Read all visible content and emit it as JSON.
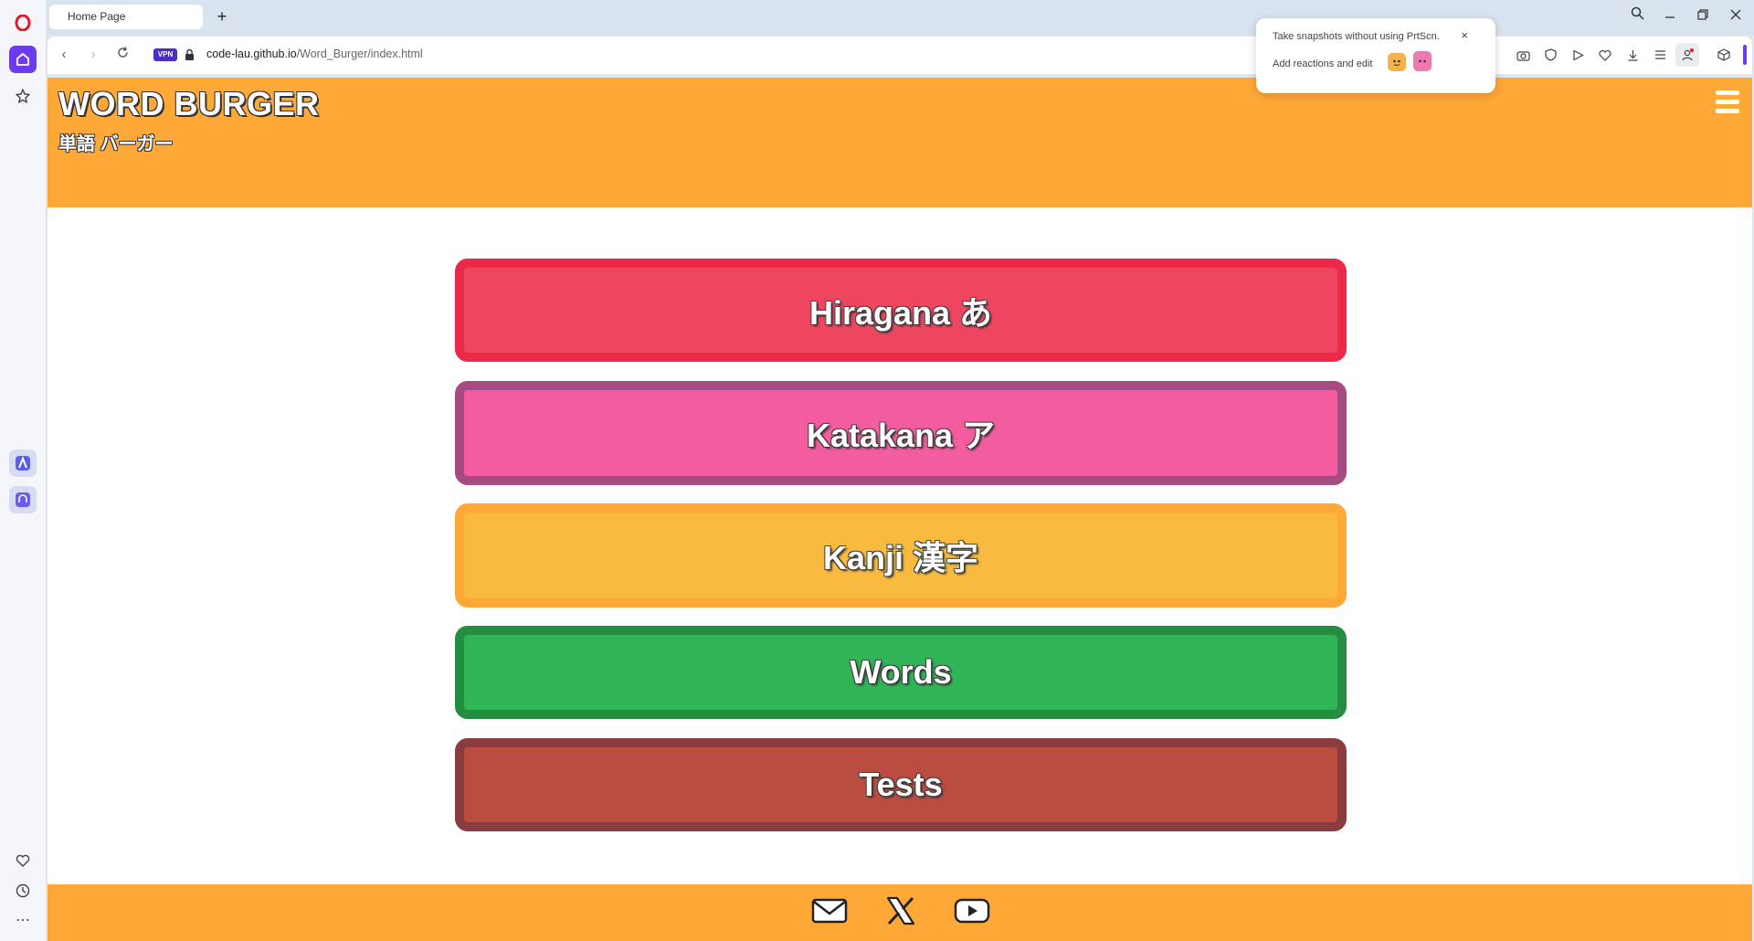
{
  "browser": {
    "tab_title": "Home Page",
    "new_tab": "+",
    "vpn_label": "VPN",
    "url_host": "code-lau.github.io",
    "url_path": "/Word_Burger/index.html",
    "popup": {
      "line1": "Take snapshots without using PrtScn.",
      "line2": "Add reactions and edit",
      "close": "×"
    }
  },
  "site": {
    "title": "WORD BURGER",
    "subtitle": "単語 バーガー"
  },
  "menu": [
    {
      "label": "Hiragana あ",
      "fill": "#ee4661",
      "border": "#ea2a48"
    },
    {
      "label": "Katakana ア",
      "fill": "#f35d9f",
      "border": "#a54b82"
    },
    {
      "label": "Kanji 漢字",
      "fill": "#f8bb3f",
      "border": "#fea837"
    },
    {
      "label": "Words",
      "fill": "#2fb556",
      "border": "#238d40"
    },
    {
      "label": "Tests",
      "fill": "#ba4c40",
      "border": "#8a3d3f"
    }
  ],
  "colors": {
    "header": "#fea837",
    "accent": "#6c3bf0"
  }
}
